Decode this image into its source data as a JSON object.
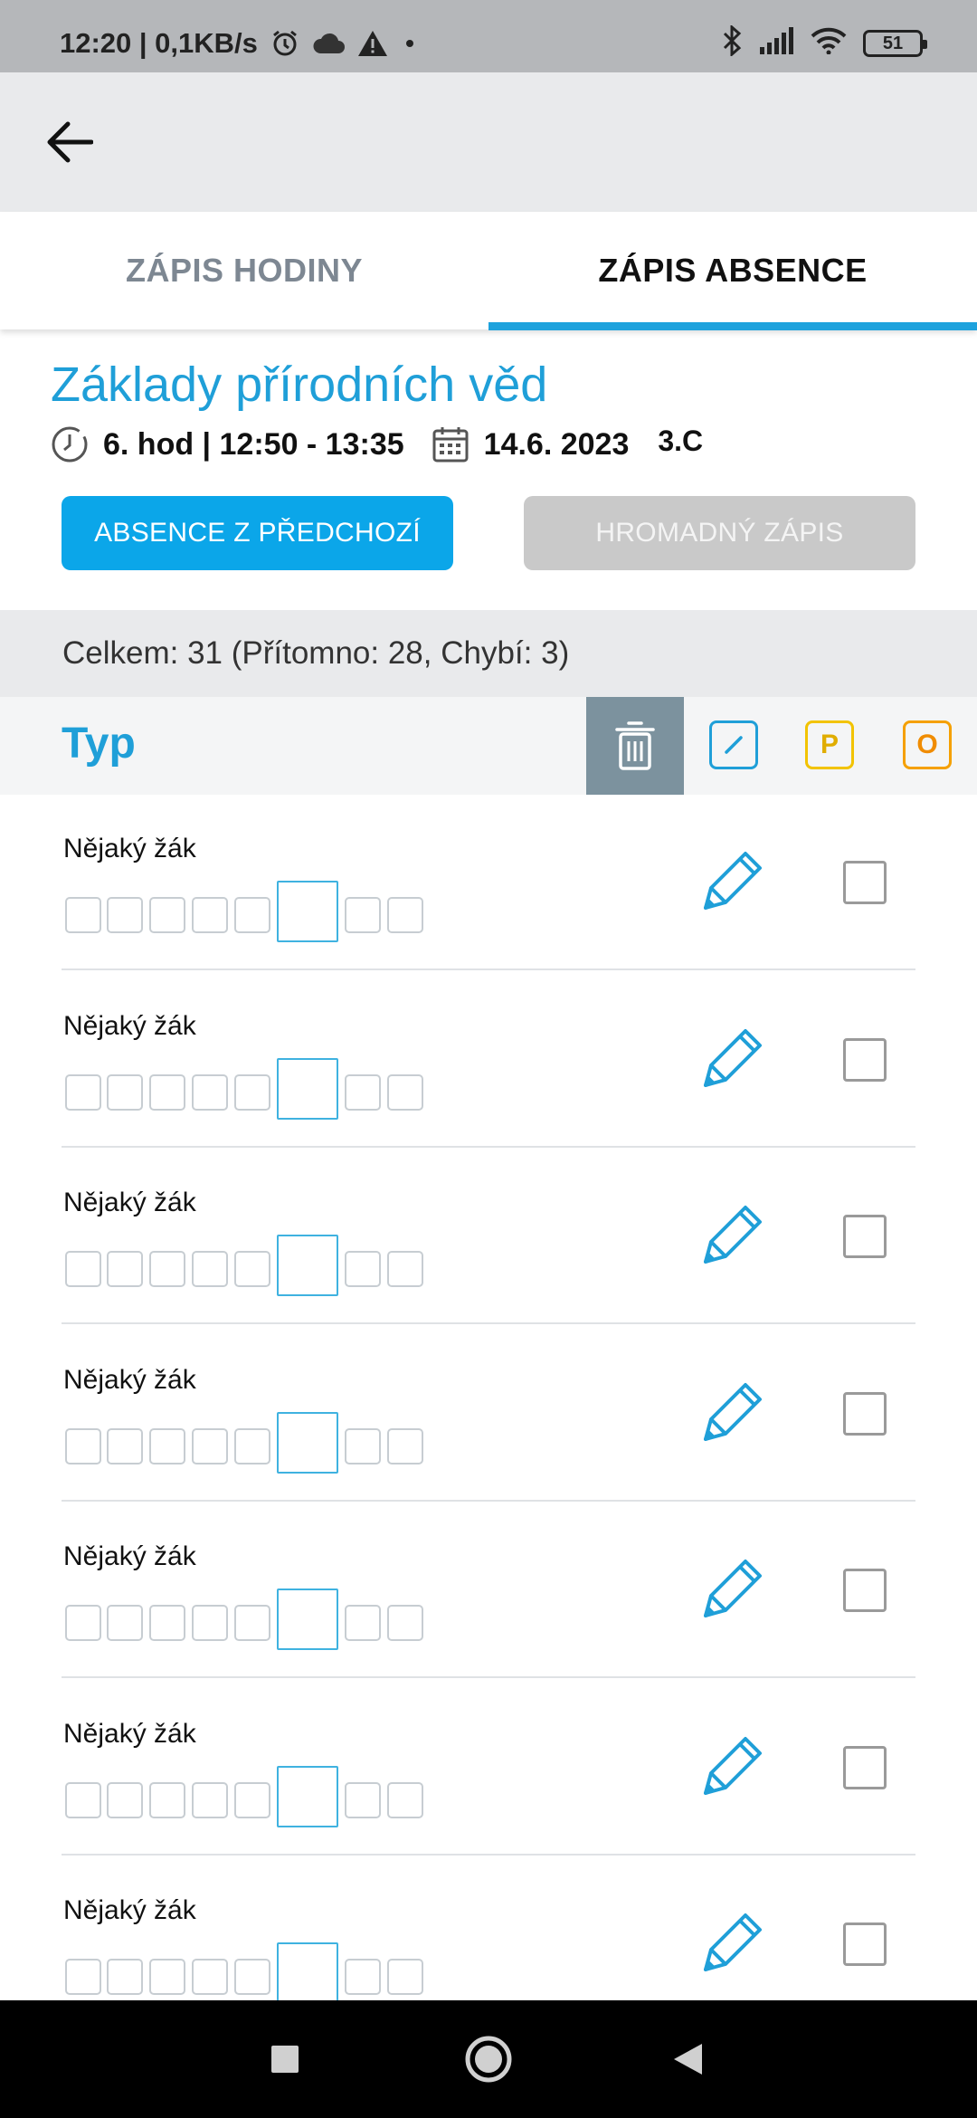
{
  "status_bar": {
    "time_speed": "12:20 | 0,1KB/s",
    "battery": "51",
    "icons": [
      "alarm-icon",
      "cloud-icon",
      "warning-icon",
      "dot-icon",
      "bluetooth-icon",
      "signal-icon",
      "wifi-icon",
      "battery-icon"
    ]
  },
  "app_bar": {
    "back_icon": "arrow-left-icon"
  },
  "tabs": [
    {
      "label": "ZÁPIS HODINY",
      "active": false
    },
    {
      "label": "ZÁPIS ABSENCE",
      "active": true
    }
  ],
  "lesson": {
    "title": "Základy přírodních věd",
    "time": "6. hod | 12:50 - 13:35",
    "date": "14.6. 2023",
    "class": "3.C"
  },
  "buttons": {
    "previous_absence": "ABSENCE Z PŘEDCHOZÍ",
    "bulk_entry": "HROMADNÝ ZÁPIS"
  },
  "summary": "Celkem: 31 (Přítomno: 28, Chybí: 3)",
  "table_header": {
    "label": "Typ",
    "p_label": "P",
    "o_label": "O"
  },
  "students": [
    {
      "name": "Nějaký žák",
      "checked": false
    },
    {
      "name": "Nějaký žák",
      "checked": false
    },
    {
      "name": "Nějaký žák",
      "checked": false
    },
    {
      "name": "Nějaký žák",
      "checked": false
    },
    {
      "name": "Nějaký žák",
      "checked": false
    },
    {
      "name": "Nějaký žák",
      "checked": false
    },
    {
      "name": "Nějaký žák",
      "checked": false
    }
  ],
  "colors": {
    "accent": "#1ea2dd",
    "primary_button": "#0ba6e9",
    "disabled_button": "#c9c9c9",
    "trash_bg": "#7c929e",
    "p_color": "#f2c300",
    "o_color": "#f5a000"
  }
}
